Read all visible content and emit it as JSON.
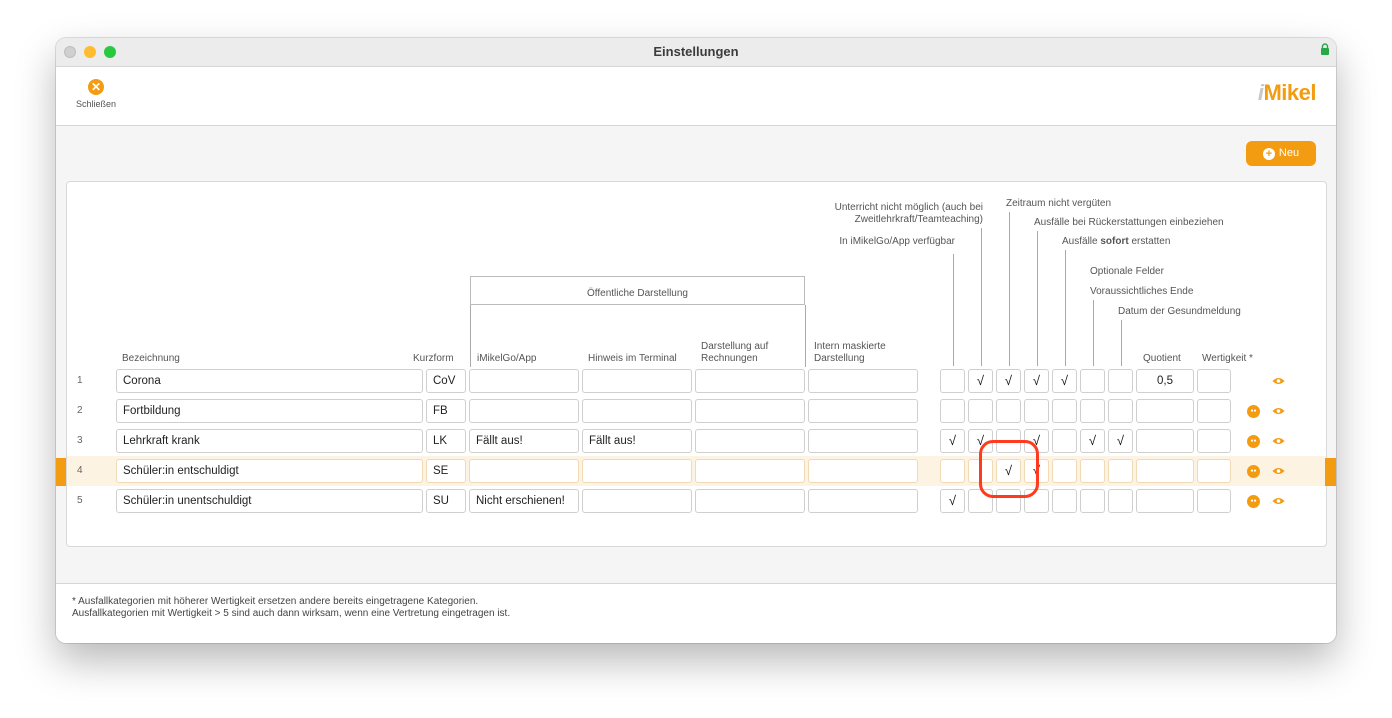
{
  "window": {
    "title": "Einstellungen"
  },
  "toolbar": {
    "close_label": "Schließen",
    "logo_prefix": "i",
    "logo_text": "Mikel"
  },
  "new_button": {
    "label": "Neu"
  },
  "headers": {
    "bezeichnung": "Bezeichnung",
    "kurzform": "Kurzform",
    "oeffentliche": "Öffentliche Darstellung",
    "imikelgo": "iMikelGo/App",
    "hinweis": "Hinweis im Terminal",
    "rechnungen_1": "Darstellung auf",
    "rechnungen_2": "Rechnungen",
    "intern_1": "Intern maskierte",
    "intern_2": "Darstellung",
    "quotient": "Quotient",
    "wertigkeit": "Wertigkeit *",
    "col_app": "In iMikelGo/App verfügbar",
    "col_unterricht_1": "Unterricht nicht möglich (auch bei",
    "col_unterricht_2": "Zweitlehrkraft/Teamteaching)",
    "col_zeitraum": "Zeitraum nicht vergüten",
    "col_rueck": "Ausfälle bei Rückerstattungen einbeziehen",
    "col_sofort_pre": "Ausfälle ",
    "col_sofort_bold": "sofort",
    "col_sofort_post": " erstatten",
    "col_optional": "Optionale Felder",
    "col_ende": "Voraussichtliches Ende",
    "col_gesund": "Datum der Gesundmeldung"
  },
  "check_mark": "√",
  "rows": [
    {
      "num": "1",
      "name": "Corona",
      "kurz": "CoV",
      "app": "",
      "hinweis": "",
      "rechnung": "",
      "intern": "",
      "checks": [
        false,
        true,
        true,
        true,
        true,
        false,
        false
      ],
      "quotient": "0,5",
      "wertigkeit": "",
      "has_group": false
    },
    {
      "num": "2",
      "name": "Fortbildung",
      "kurz": "FB",
      "app": "",
      "hinweis": "",
      "rechnung": "",
      "intern": "",
      "checks": [
        false,
        false,
        false,
        false,
        false,
        false,
        false
      ],
      "quotient": "",
      "wertigkeit": "",
      "has_group": true
    },
    {
      "num": "3",
      "name": "Lehrkraft krank",
      "kurz": "LK",
      "app": "Fällt aus!",
      "hinweis": "Fällt aus!",
      "rechnung": "",
      "intern": "",
      "checks": [
        true,
        true,
        false,
        true,
        false,
        true,
        true
      ],
      "quotient": "",
      "wertigkeit": "",
      "has_group": true
    },
    {
      "num": "4",
      "name": "Schüler:in entschuldigt",
      "kurz": "SE",
      "app": "",
      "hinweis": "",
      "rechnung": "",
      "intern": "",
      "checks": [
        false,
        false,
        true,
        true,
        false,
        false,
        false
      ],
      "quotient": "",
      "wertigkeit": "",
      "has_group": true,
      "selected": true
    },
    {
      "num": "5",
      "name": "Schüler:in unentschuldigt",
      "kurz": "SU",
      "app": "Nicht erschienen!",
      "hinweis": "",
      "rechnung": "",
      "intern": "",
      "checks": [
        true,
        false,
        false,
        false,
        false,
        false,
        false
      ],
      "quotient": "",
      "wertigkeit": "",
      "has_group": true
    }
  ],
  "footer": {
    "line1": "* Ausfallkategorien mit höherer Wertigkeit ersetzen andere bereits eingetragene Kategorien.",
    "line2": "Ausfallkategorien mit Wertigkeit > 5 sind auch dann wirksam, wenn eine Vertretung eingetragen ist."
  },
  "colors": {
    "accent": "#f39c12",
    "highlight": "#ff3b1f"
  },
  "icons": {
    "close": "close-circle-icon",
    "new": "plus-circle-icon",
    "group": "group-icon",
    "eye": "eye-icon",
    "lock": "lock-icon"
  }
}
